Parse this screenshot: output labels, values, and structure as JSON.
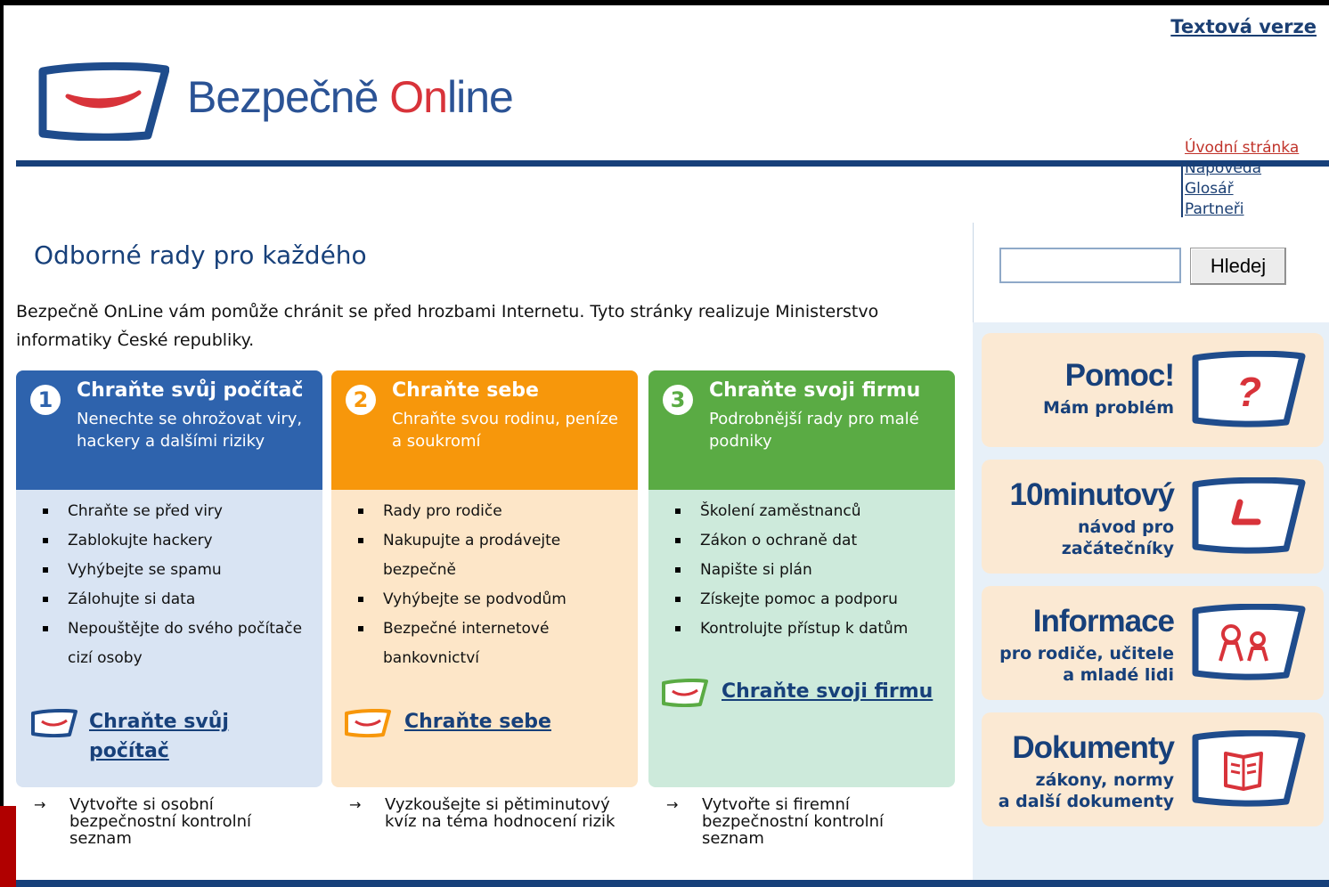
{
  "header": {
    "text_version": "Textová verze",
    "brand_part1": "Bezpečně ",
    "brand_on": "On",
    "brand_part2": "line"
  },
  "top_nav": [
    "Úvodní stránka",
    "Nápověda",
    "Glosář",
    "Partneři"
  ],
  "search": {
    "button": "Hledej",
    "value": ""
  },
  "main": {
    "heading": "Odborné rady pro každého",
    "intro": "Bezpečně OnLine vám pomůže chránit se před hrozbami Internetu. Tyto stránky realizuje Ministerstvo informatiky České republiky."
  },
  "boxes": [
    {
      "number": "1",
      "title": "Chraňte svůj počítač",
      "subtitle": "Nenechte se ohrožovat viry, hackery a dalšími riziky",
      "items": [
        "Chraňte se před viry",
        "Zablokujte hackery",
        "Vyhýbejte se spamu",
        "Zálohujte si data",
        "Nepouštějte do svého počítače cizí osoby"
      ],
      "cta": "Chraňte svůj počítač",
      "note": "Vytvořte si osobní bezpečnostní kontrolní seznam"
    },
    {
      "number": "2",
      "title": "Chraňte sebe",
      "subtitle": "Chraňte svou rodinu, peníze a soukromí",
      "items": [
        "Rady pro rodiče",
        "Nakupujte a prodávejte bezpečně",
        "Vyhýbejte se podvodům",
        "Bezpečné internetové bankovnictví"
      ],
      "cta": "Chraňte sebe",
      "note": "Vyzkoušejte si pětiminutový kvíz na téma hodnocení rizik"
    },
    {
      "number": "3",
      "title": "Chraňte svoji firmu",
      "subtitle": "Podrobnější rady pro malé podniky",
      "items": [
        "Školení zaměstnanců",
        "Zákon o ochraně dat",
        "Napište si plán",
        "Získejte pomoc a podporu",
        "Kontrolujte přístup k datům"
      ],
      "cta": "Chraňte svoji firmu",
      "note": "Vytvořte si firemní bezpečnostní kontrolní seznam"
    }
  ],
  "promos": [
    {
      "title": "Pomoc!",
      "line1": "Mám problém",
      "line2": "",
      "icon": "question-icon"
    },
    {
      "title": "10minutový",
      "line1": "návod pro",
      "line2": "začátečníky",
      "icon": "clock-icon"
    },
    {
      "title": "Informace",
      "line1": "pro rodiče, učitele",
      "line2": "a mladé lidi",
      "icon": "people-icon"
    },
    {
      "title": "Dokumenty",
      "line1": "zákony, normy",
      "line2": "a další dokumenty",
      "icon": "document-icon"
    }
  ],
  "colors": {
    "navy": "#17407a",
    "blue_box": "#2e63ad",
    "orange_box": "#f7970b",
    "green_box": "#5aab44",
    "brand_red": "#d8333a"
  },
  "arrow_glyph": "→"
}
